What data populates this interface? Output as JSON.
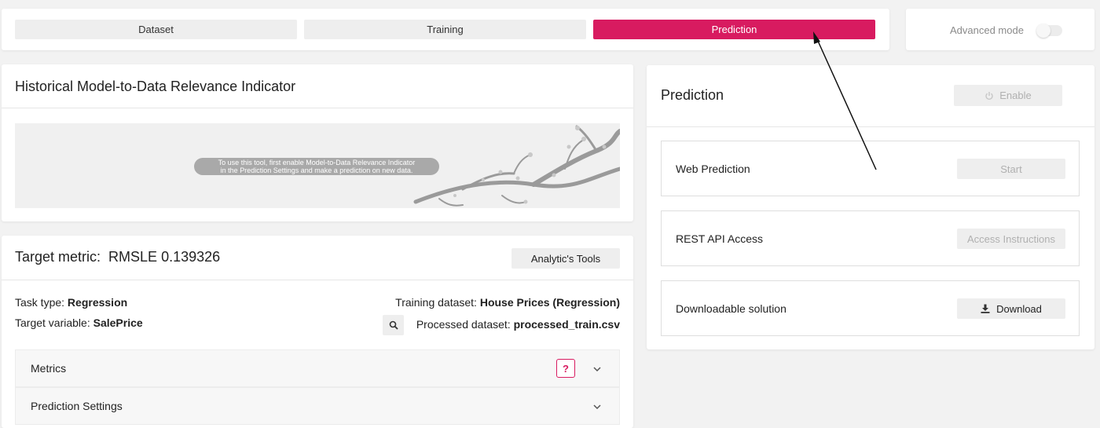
{
  "nav": {
    "steps": [
      "Dataset",
      "Training",
      "Prediction"
    ],
    "active": "Prediction",
    "advanced_mode_label": "Advanced mode"
  },
  "historical": {
    "title": "Historical Model-to-Data Relevance Indicator",
    "notice_line1": "To use this tool, first enable Model-to-Data Relevance Indicator",
    "notice_line2": "in the Prediction Settings and make a prediction on new data."
  },
  "target": {
    "title_prefix": "Target metric:",
    "title_value": "RMSLE 0.139326",
    "tools_button": "Analytic's Tools",
    "task_type_label": "Task type:",
    "task_type_value": "Regression",
    "target_variable_label": "Target variable:",
    "target_variable_value": "SalePrice",
    "training_dataset_label": "Training dataset:",
    "training_dataset_value": "House Prices (Regression)",
    "processed_dataset_label": "Processed dataset:",
    "processed_dataset_value": "processed_train.csv",
    "accordions": [
      "Metrics",
      "Prediction Settings"
    ],
    "help_badge": "?"
  },
  "prediction": {
    "title": "Prediction",
    "enable_button": "Enable",
    "rows": [
      {
        "label": "Web Prediction",
        "button": "Start"
      },
      {
        "label": "REST API Access",
        "button": "Access Instructions"
      },
      {
        "label": "Downloadable solution",
        "button": "Download"
      }
    ]
  },
  "colors": {
    "accent": "#d81b60",
    "background": "#f2f2f2"
  }
}
